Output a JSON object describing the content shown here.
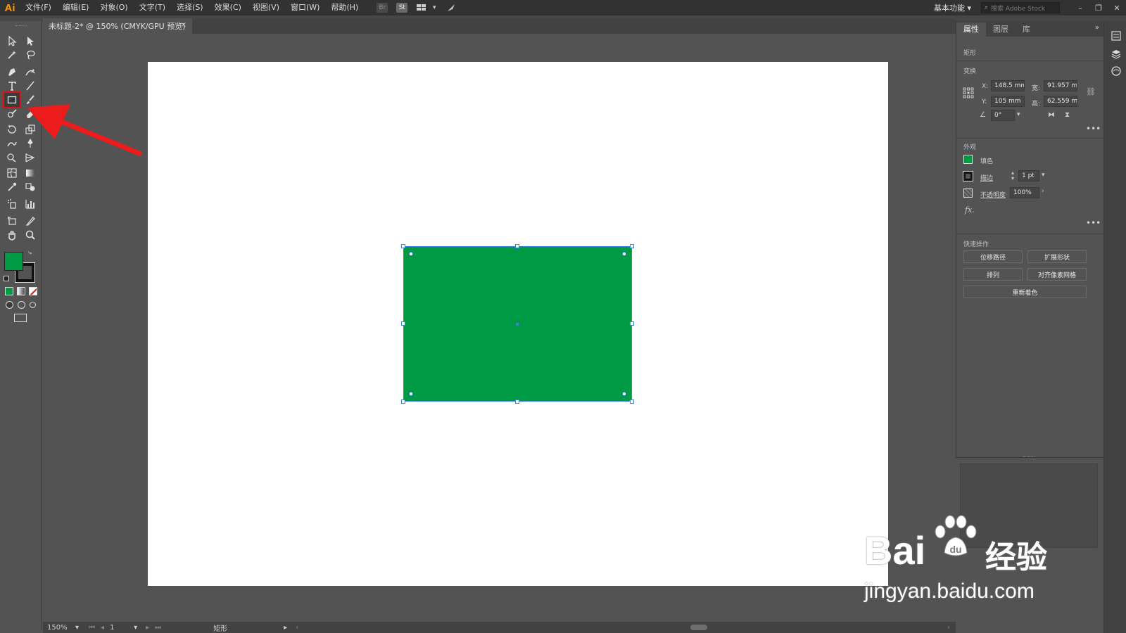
{
  "app": {
    "logo": "Ai",
    "menu": [
      "文件(F)",
      "编辑(E)",
      "对象(O)",
      "文字(T)",
      "选择(S)",
      "效果(C)",
      "视图(V)",
      "窗口(W)",
      "帮助(H)"
    ],
    "workspace": "基本功能",
    "search_placeholder": "搜索 Adobe Stock",
    "mb_icons": [
      "Br",
      "St"
    ]
  },
  "document": {
    "tab_title": "未标题-2* @ 150% (CMYK/GPU 预览)",
    "close": "×"
  },
  "canvas": {
    "shape_color": "#009a44",
    "selection_color": "#3a86d8"
  },
  "properties": {
    "tabs": [
      "属性",
      "图层",
      "库"
    ],
    "object_type": "矩形",
    "transform_label": "变换",
    "x_label": "X:",
    "x_value": "148.5 mm",
    "y_label": "Y:",
    "y_value": "105 mm",
    "w_label": "宽:",
    "w_value": "91.957 m",
    "h_label": "高:",
    "h_value": "62.559 m",
    "angle_value": "0°",
    "appearance_label": "外观",
    "fill_label": "填色",
    "stroke_label": "描边",
    "stroke_value": "1 pt",
    "opacity_label": "不透明度",
    "opacity_value": "100%",
    "fx_label": "fx.",
    "quick_actions_label": "快速操作",
    "btn_offset_path": "位移路径",
    "btn_expand_shape": "扩展形状",
    "btn_arrange": "排列",
    "btn_align_pixel": "对齐像素网格",
    "btn_recolor": "重新着色",
    "more": "•••"
  },
  "status": {
    "zoom": "150%",
    "artboard_num": "1",
    "selection_label": "矩形"
  },
  "swatches": {
    "fill": "#009a44",
    "stroke": "#000000"
  },
  "watermark": {
    "brand_left": "Bai",
    "brand_right": "经验",
    "url": "jingyan.baidu.com"
  }
}
